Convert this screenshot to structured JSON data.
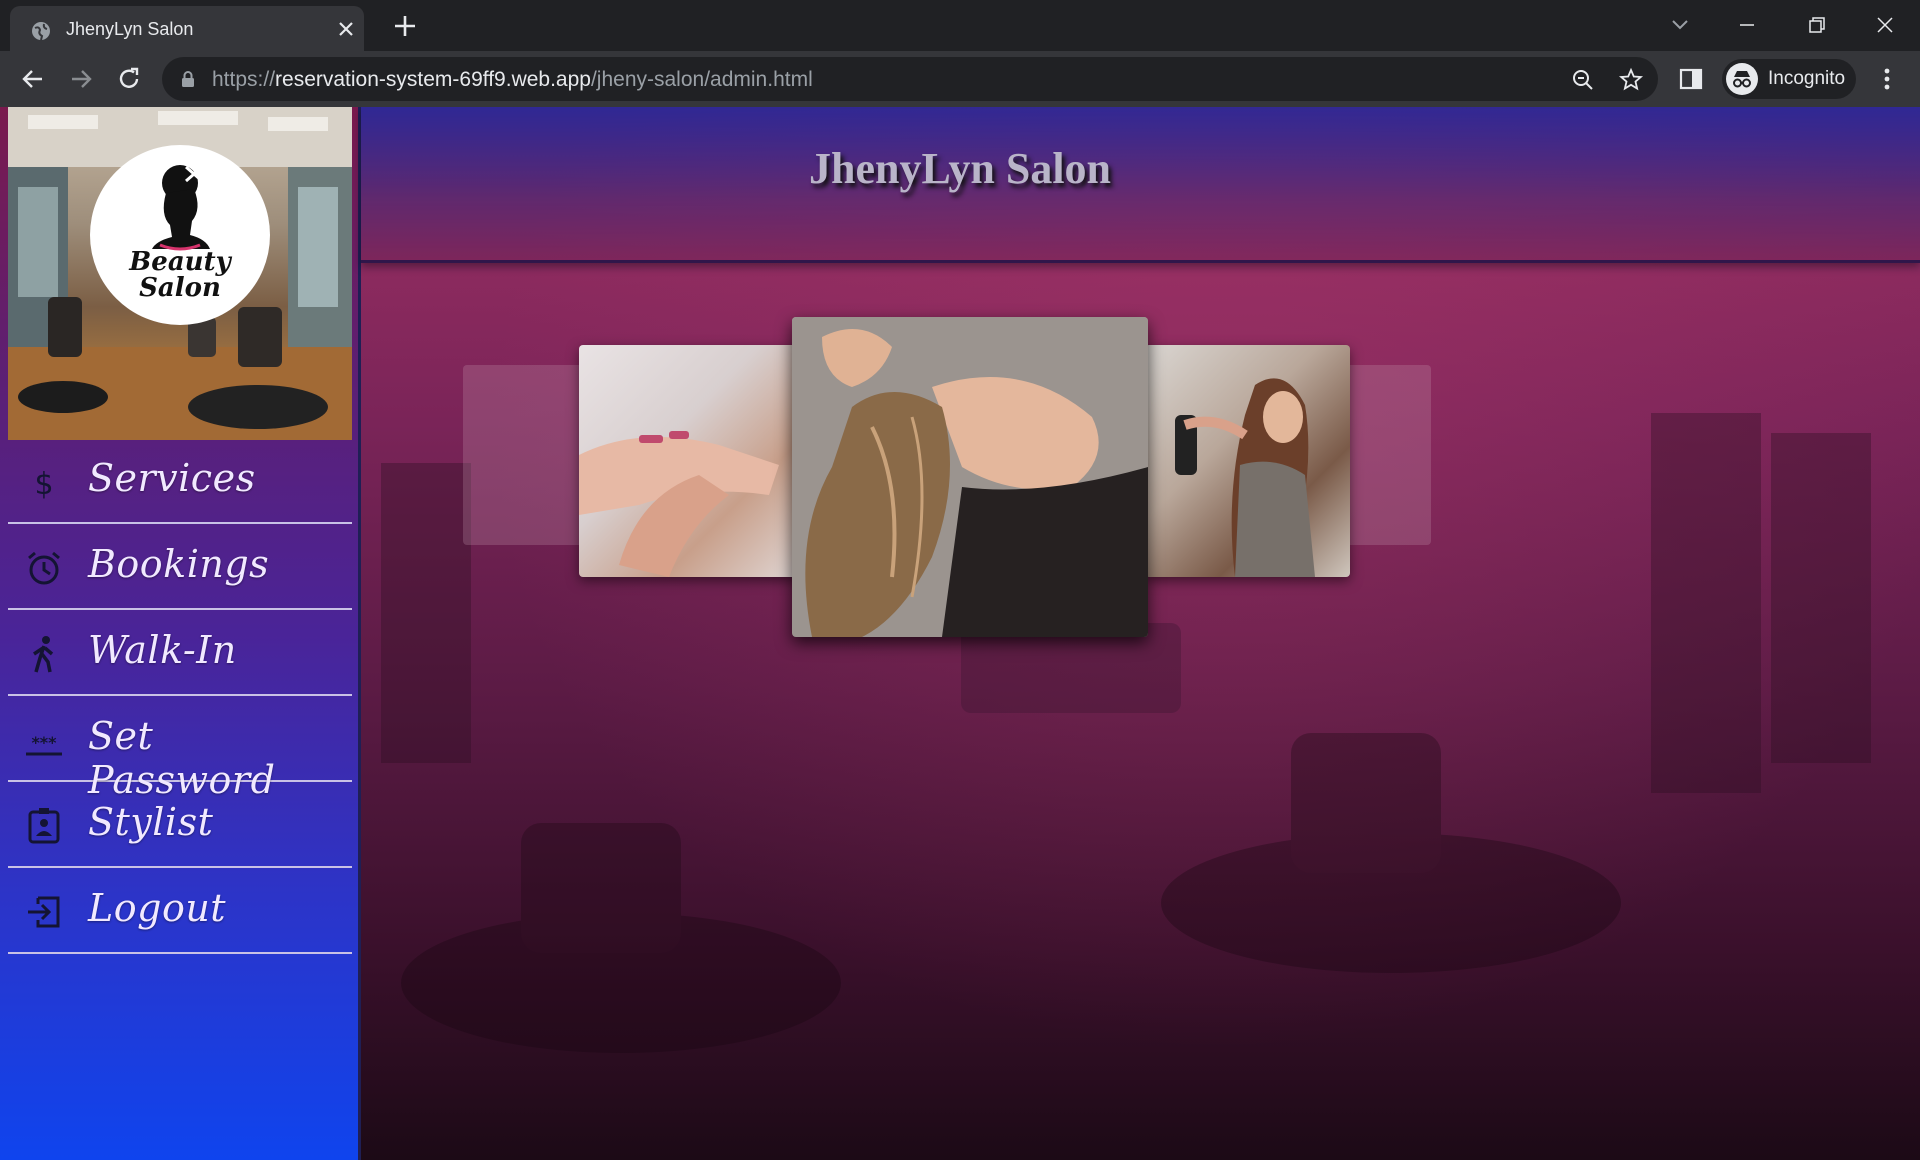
{
  "browser": {
    "tab_title": "JhenyLyn Salon",
    "url_scheme": "https://",
    "url_host": "reservation-system-69ff9.web.app",
    "url_path": "/jheny-salon/admin.html",
    "profile_label": "Incognito"
  },
  "sidebar": {
    "logo_text": "Beauty Salon",
    "items": [
      {
        "label": "Services",
        "icon": "dollar-icon"
      },
      {
        "label": "Bookings",
        "icon": "alarm-clock-icon"
      },
      {
        "label": "Walk-In",
        "icon": "walking-person-icon"
      },
      {
        "label": "Set Password",
        "icon": "password-asterisks-icon"
      },
      {
        "label": "Stylist",
        "icon": "id-badge-icon"
      },
      {
        "label": "Logout",
        "icon": "logout-icon"
      }
    ]
  },
  "header": {
    "title": "JhenyLyn Salon"
  },
  "carousel": {
    "slides": [
      "pedicure-photo",
      "hair-washing-photo",
      "hair-styling-photo"
    ]
  },
  "colors": {
    "sidebar_top": "#7a1a4e",
    "sidebar_bottom": "#0f44ee",
    "header_bg": "#2d2896",
    "page_bg": "#5c1b45"
  }
}
